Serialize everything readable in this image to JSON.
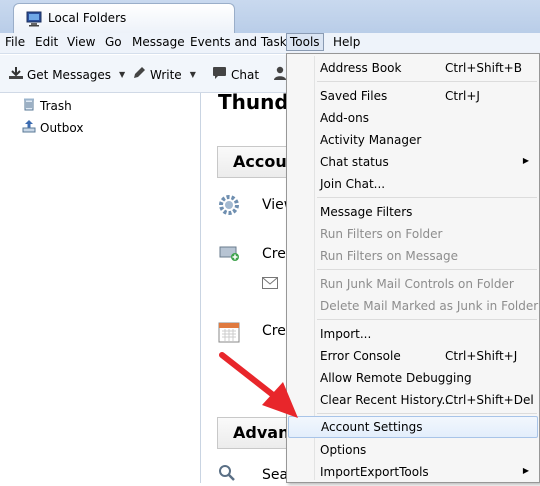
{
  "tab": {
    "title": "Local Folders"
  },
  "menubar": {
    "file": "File",
    "edit": "Edit",
    "view": "View",
    "go": "Go",
    "message": "Message",
    "events": "Events and Tasks",
    "tools": "Tools",
    "help": "Help"
  },
  "toolbar": {
    "get_messages": "Get Messages",
    "write": "Write",
    "chat": "Chat"
  },
  "folders": [
    {
      "label": "Trash"
    },
    {
      "label": "Outbox"
    }
  ],
  "content": {
    "title": "Thunde",
    "section1": "Accou",
    "row_view": "View",
    "row_create1": "Cre",
    "row_create2": "Cre",
    "section2": "Advan",
    "row_search": "Sea"
  },
  "menu": {
    "address_book": "Address Book",
    "address_book_sc": "Ctrl+Shift+B",
    "saved_files": "Saved Files",
    "saved_files_sc": "Ctrl+J",
    "addons": "Add-ons",
    "activity_manager": "Activity Manager",
    "chat_status": "Chat status",
    "join_chat": "Join Chat...",
    "message_filters": "Message Filters",
    "run_filters_folder": "Run Filters on Folder",
    "run_filters_message": "Run Filters on Message",
    "run_junk": "Run Junk Mail Controls on Folder",
    "delete_junk": "Delete Mail Marked as Junk in Folder",
    "import": "Import...",
    "error_console": "Error Console",
    "error_console_sc": "Ctrl+Shift+J",
    "remote_debug": "Allow Remote Debugging",
    "clear_history": "Clear Recent History...",
    "clear_history_sc": "Ctrl+Shift+Del",
    "account_settings": "Account Settings",
    "options": "Options",
    "importexport": "ImportExportTools"
  },
  "colors": {
    "arrow": "#e8262b",
    "highlight_border": "#a8c4e8"
  }
}
